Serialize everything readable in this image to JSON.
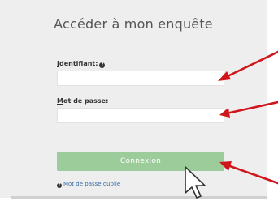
{
  "login": {
    "title": "Accéder à mon enquête",
    "identifiant_label_first": "I",
    "identifiant_label_rest": "dentifiant:",
    "identifiant_value": "",
    "password_label_first": "M",
    "password_label_rest": "ot de passe:",
    "password_value": "",
    "submit_label": "Connexion",
    "forgot_label": "Mot de passe oublié"
  },
  "icons": {
    "help": "question-circle-icon",
    "cursor": "mouse-pointer-icon",
    "arrow": "red-arrow-icon"
  },
  "colors": {
    "panel": "#eeeeee",
    "button": "#9ccc9a",
    "link": "#3a6ea5",
    "arrow": "#d0161b"
  }
}
